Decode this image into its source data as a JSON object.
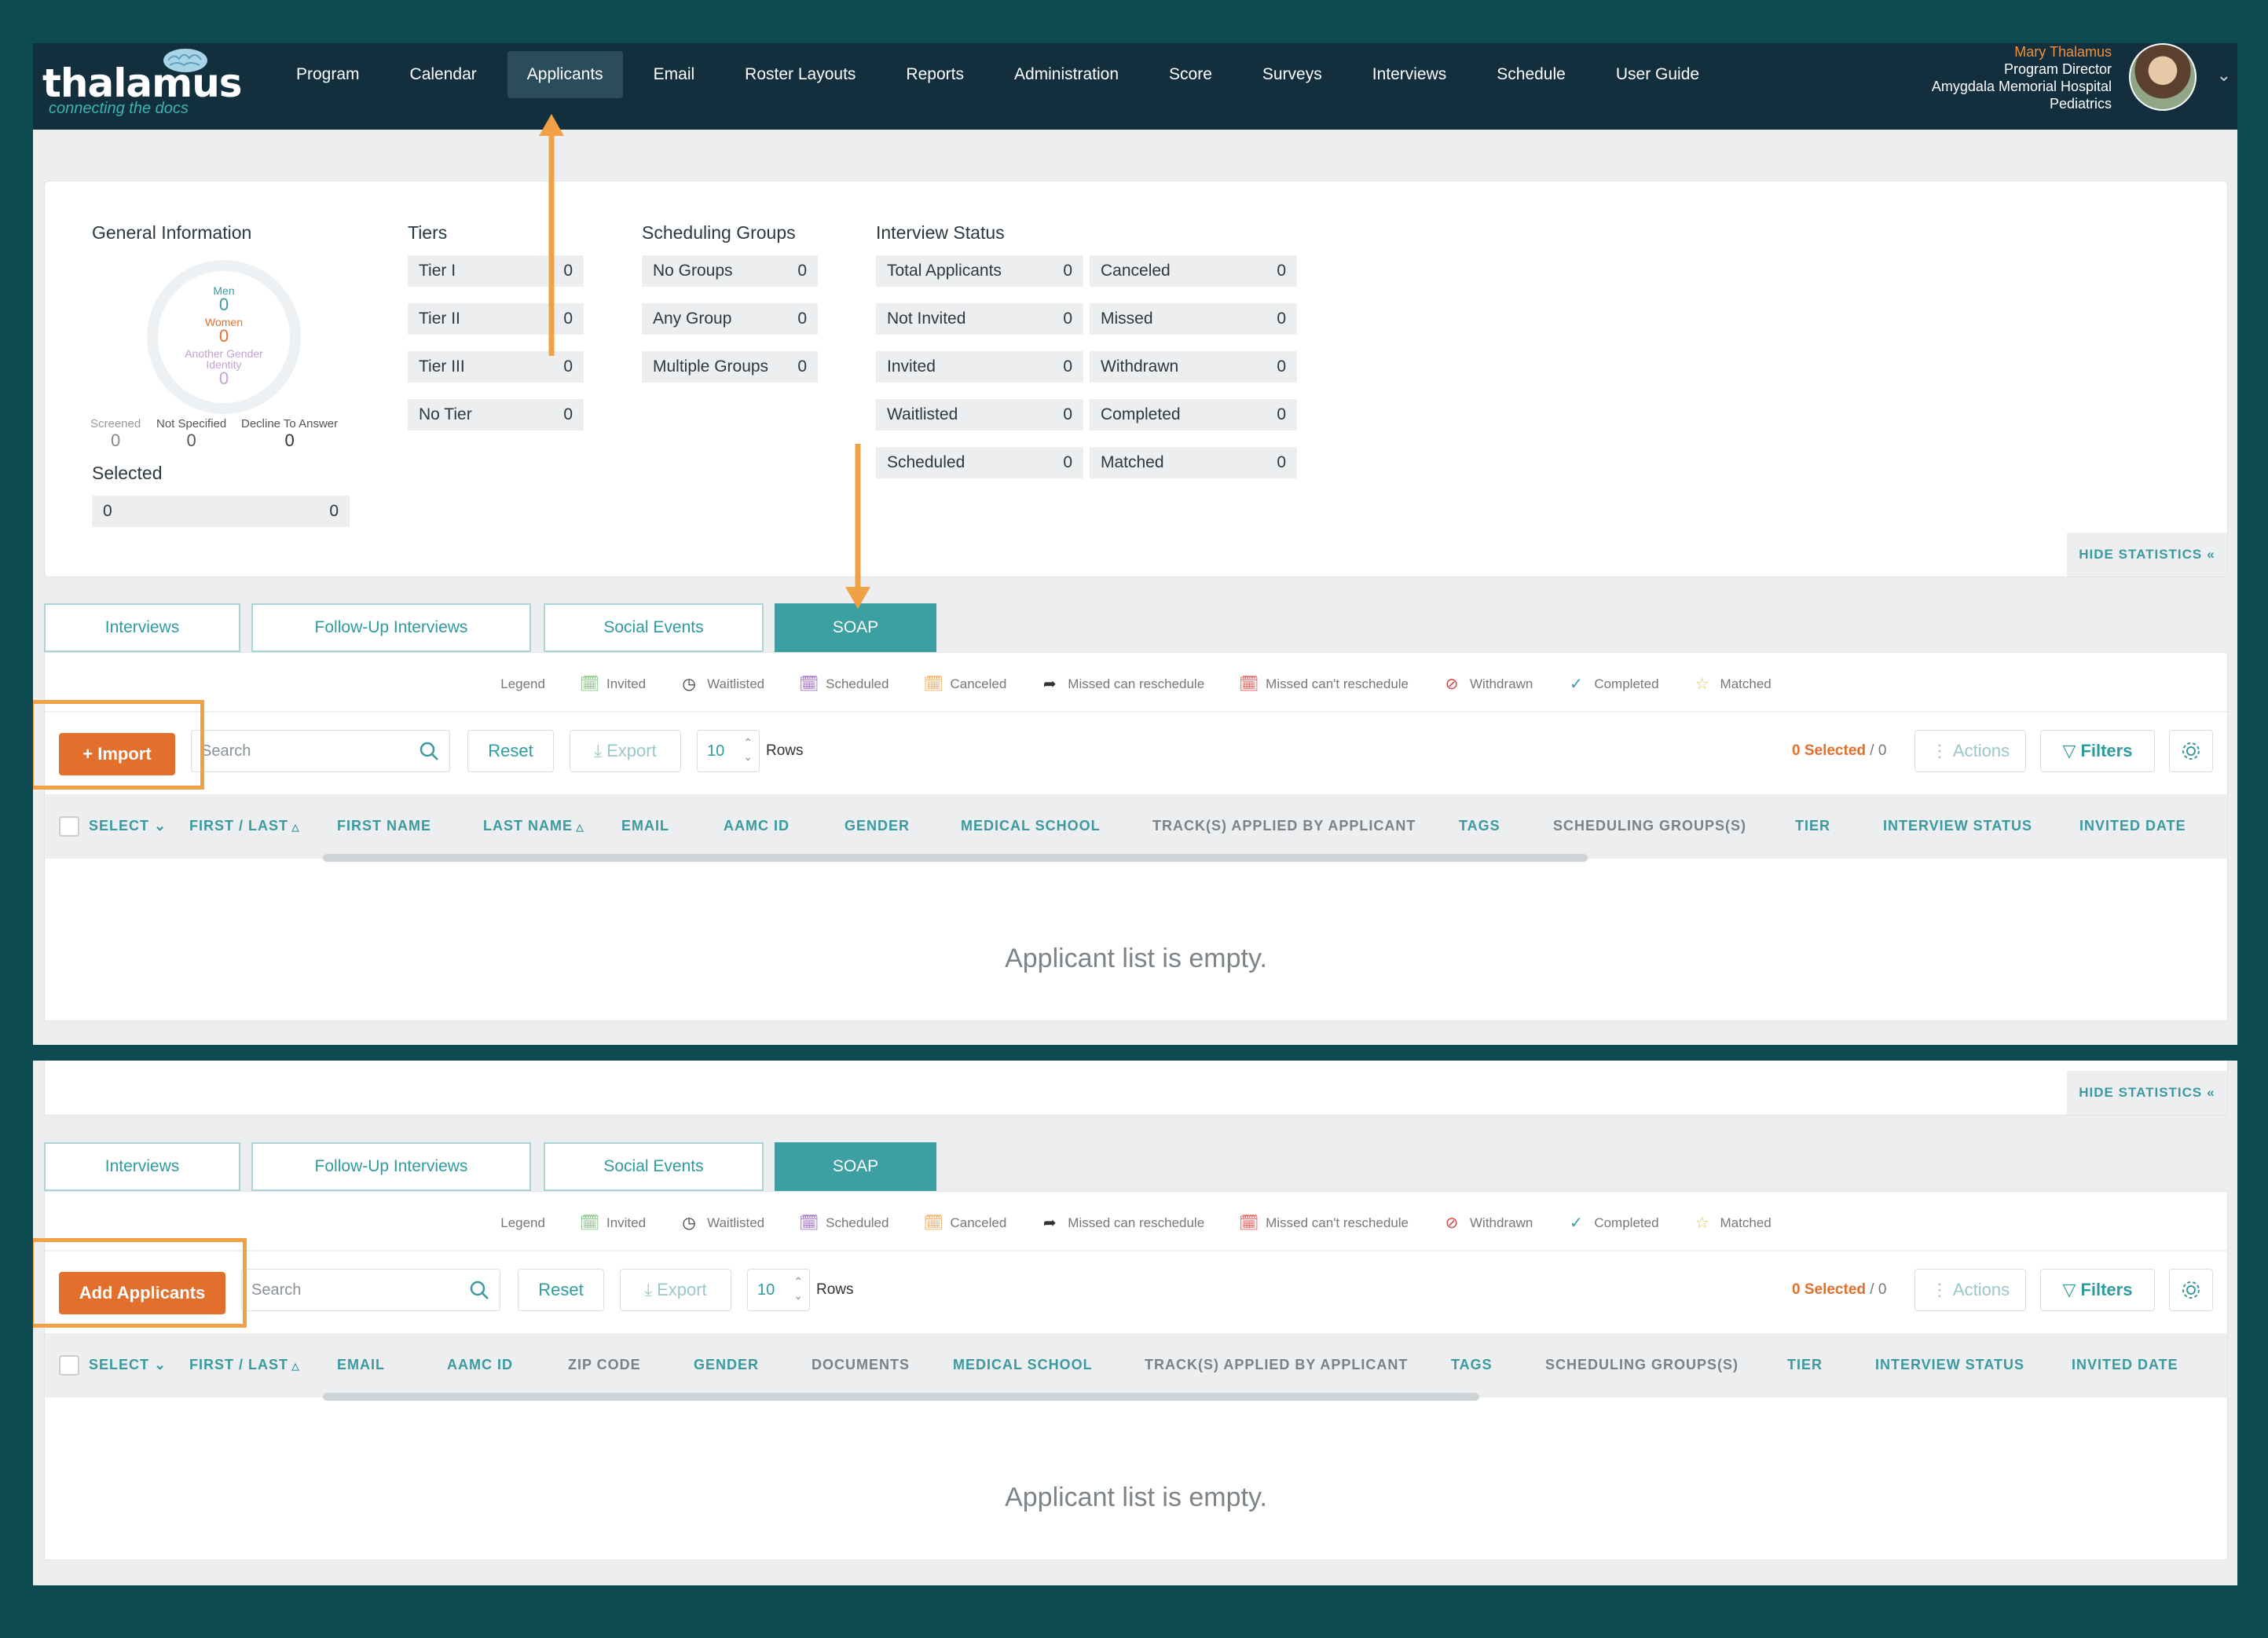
{
  "app": {
    "logo_text": "thalamus",
    "logo_tagline": "connecting the docs"
  },
  "nav": [
    "Program",
    "Calendar",
    "Applicants",
    "Email",
    "Roster Layouts",
    "Reports",
    "Administration",
    "Score",
    "Surveys",
    "Interviews",
    "Schedule",
    "User Guide"
  ],
  "user": {
    "name": "Mary Thalamus",
    "role": "Program Director",
    "hospital": "Amygdala Memorial Hospital",
    "department": "Pediatrics"
  },
  "stats": {
    "general_title": "General Information",
    "men_label": "Men",
    "men_value": "0",
    "women_label": "Women",
    "women_value": "0",
    "another_label": "Another Gender Identity",
    "another_value": "0",
    "screened_label": "Screened",
    "screened_value": "0",
    "not_specified_label": "Not Specified",
    "not_specified_value": "0",
    "decline_label": "Decline To Answer",
    "decline_value": "0",
    "selected_title": "Selected",
    "selected_left": "0",
    "selected_right": "0",
    "tiers_title": "Tiers",
    "tiers": [
      {
        "label": "Tier I",
        "value": "0"
      },
      {
        "label": "Tier II",
        "value": "0"
      },
      {
        "label": "Tier III",
        "value": "0"
      },
      {
        "label": "No Tier",
        "value": "0"
      }
    ],
    "groups_title": "Scheduling Groups",
    "groups": [
      {
        "label": "No Groups",
        "value": "0"
      },
      {
        "label": "Any Group",
        "value": "0"
      },
      {
        "label": "Multiple Groups",
        "value": "0"
      }
    ],
    "status_title": "Interview Status",
    "status_left": [
      {
        "label": "Total Applicants",
        "value": "0"
      },
      {
        "label": "Not Invited",
        "value": "0"
      },
      {
        "label": "Invited",
        "value": "0"
      },
      {
        "label": "Waitlisted",
        "value": "0"
      },
      {
        "label": "Scheduled",
        "value": "0"
      }
    ],
    "status_right": [
      {
        "label": "Canceled",
        "value": "0"
      },
      {
        "label": "Missed",
        "value": "0"
      },
      {
        "label": "Withdrawn",
        "value": "0"
      },
      {
        "label": "Completed",
        "value": "0"
      },
      {
        "label": "Matched",
        "value": "0"
      }
    ],
    "hide_label": "HIDE STATISTICS"
  },
  "tabs": [
    "Interviews",
    "Follow-Up Interviews",
    "Social Events",
    "SOAP"
  ],
  "legend": {
    "title": "Legend",
    "items": [
      "Invited",
      "Waitlisted",
      "Scheduled",
      "Canceled",
      "Missed can reschedule",
      "Missed can't reschedule",
      "Withdrawn",
      "Completed",
      "Matched"
    ]
  },
  "toolbar": {
    "import_label": "+ Import",
    "add_label": "Add Applicants",
    "search_placeholder": "Search",
    "reset_label": "Reset",
    "export_label": "Export",
    "rows_value": "10",
    "rows_label": "Rows",
    "selected_text": "0 Selected",
    "selected_total": " / 0",
    "actions_label": "Actions",
    "filters_label": "Filters"
  },
  "table1": {
    "select": "SELECT",
    "columns": [
      "FIRST / LAST",
      "FIRST NAME",
      "LAST NAME",
      "EMAIL",
      "AAMC ID",
      "GENDER",
      "MEDICAL SCHOOL",
      "TRACK(S) APPLIED BY APPLICANT",
      "TAGS",
      "SCHEDULING GROUPS(S)",
      "TIER",
      "INTERVIEW STATUS",
      "INVITED DATE"
    ]
  },
  "table2": {
    "select": "SELECT",
    "columns": [
      "FIRST / LAST",
      "EMAIL",
      "AAMC ID",
      "ZIP CODE",
      "GENDER",
      "DOCUMENTS",
      "MEDICAL SCHOOL",
      "TRACK(S) APPLIED BY APPLICANT",
      "TAGS",
      "SCHEDULING GROUPS(S)",
      "TIER",
      "INTERVIEW STATUS",
      "INVITED DATE"
    ]
  },
  "empty_text": "Applicant list is empty.",
  "colors": {
    "accent": "#3c9fa1",
    "orange": "#e36f2d",
    "annotation": "#f0a146",
    "header": "#132f3d",
    "frame": "#0d4a52"
  }
}
